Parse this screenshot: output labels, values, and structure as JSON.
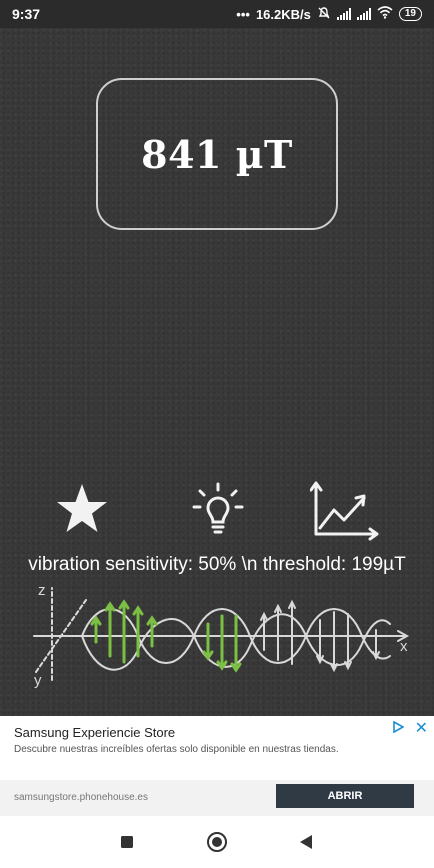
{
  "status_bar": {
    "time": "9:37",
    "network_speed": "16.2KB/s",
    "battery_level": "19",
    "icons": [
      "dots-icon",
      "mute-icon",
      "signal-icon",
      "signal-icon",
      "wifi-icon",
      "battery-icon"
    ]
  },
  "meter": {
    "reading": "841 µT"
  },
  "toolbar": {
    "icons": [
      "star-icon",
      "lightbulb-icon",
      "graph-icon"
    ]
  },
  "settings": {
    "sensitivity_text": "vibration sensitivity: 50% \\n threshold: 199µT"
  },
  "illustration": {
    "axis_labels": {
      "z": "z",
      "y": "y",
      "x": "x"
    },
    "colors": {
      "highlight": "#7cc043",
      "lines": "#d9d9d9"
    }
  },
  "ad": {
    "title": "Samsung Experiencie Store",
    "description": "Descubre nuestras increíbles ofertas solo disponible en nuestras tiendas.",
    "url": "samsungstore.phonehouse.es",
    "cta": "ABRIR",
    "accent": "#1b8fd6"
  },
  "nav_bar": {
    "icons": [
      "recents-square-icon",
      "home-circle-icon",
      "back-triangle-icon"
    ]
  }
}
